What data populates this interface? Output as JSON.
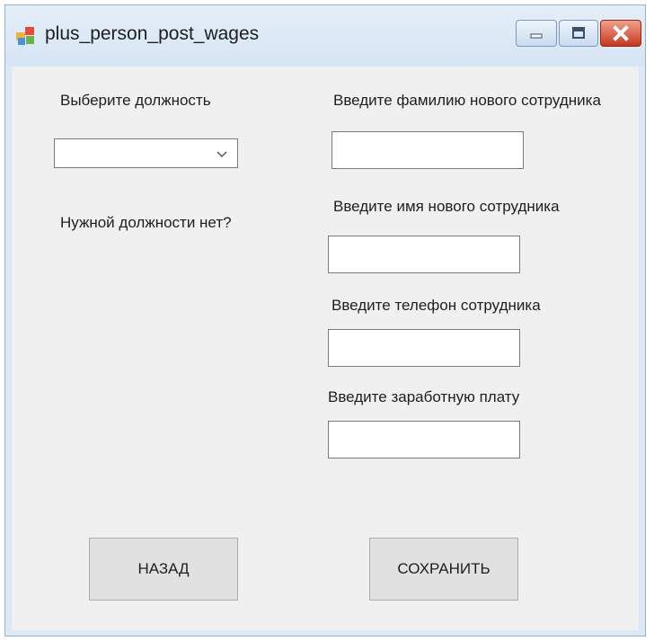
{
  "window": {
    "title": "plus_person_post_wages"
  },
  "position": {
    "label": "Выберите должность",
    "selected_value": ""
  },
  "missing_position": {
    "label": "Нужной должности нет?"
  },
  "surname": {
    "label": "Введите фамилию нового сотрудника",
    "value": ""
  },
  "first_name": {
    "label": "Введите имя нового сотрудника",
    "value": ""
  },
  "phone": {
    "label": "Введите телефон сотрудника",
    "value": ""
  },
  "salary": {
    "label": "Введите заработную плату",
    "value": ""
  },
  "buttons": {
    "back": "НАЗАД",
    "save": "СОХРАНИТЬ"
  },
  "icons": {
    "app": "app-icon",
    "minimize": "minimize-icon",
    "maximize": "maximize-icon",
    "close": "close-icon",
    "dropdown": "chevron-down-icon"
  },
  "colors": {
    "title_bar": "#d6e5f4",
    "form_background": "#f0f0f0",
    "close_button": "#c6371c",
    "button_face": "#e1e1e1"
  }
}
